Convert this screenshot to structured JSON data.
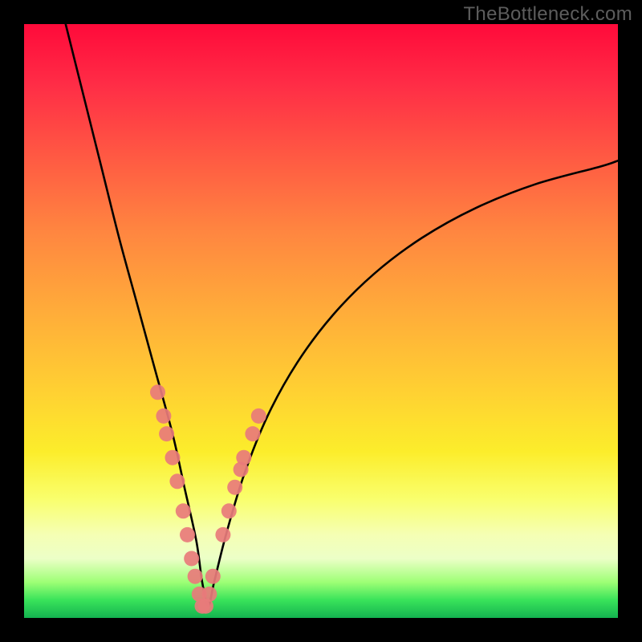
{
  "watermark_text": "TheBottleneck.com",
  "chart_data": {
    "type": "line",
    "title": "",
    "xlabel": "",
    "ylabel": "",
    "xlim": [
      0,
      100
    ],
    "ylim": [
      0,
      100
    ],
    "grid": false,
    "legend": false,
    "background_gradient": {
      "stops": [
        {
          "pos": 0,
          "color": "#ff0a3a"
        },
        {
          "pos": 35,
          "color": "#ff8640"
        },
        {
          "pos": 62,
          "color": "#ffd132"
        },
        {
          "pos": 80,
          "color": "#f9ff6d"
        },
        {
          "pos": 90,
          "color": "#ecffc7"
        },
        {
          "pos": 100,
          "color": "#14b350"
        }
      ]
    },
    "series": [
      {
        "name": "bottleneck-curve",
        "color": "#000000",
        "x": [
          7,
          10,
          13,
          16,
          19,
          22,
          25,
          27,
          29,
          30,
          31,
          32,
          34,
          37,
          41,
          46,
          52,
          59,
          67,
          76,
          86,
          97,
          100
        ],
        "y": [
          100,
          88,
          76,
          64,
          53,
          42,
          31,
          22,
          13,
          6,
          2,
          6,
          14,
          24,
          34,
          43,
          51,
          58,
          64,
          69,
          73,
          76,
          77
        ]
      },
      {
        "name": "highlight-dots",
        "type": "scatter",
        "color": "#e87b7b",
        "x": [
          22.5,
          23.5,
          24.0,
          25.0,
          25.8,
          26.8,
          27.5,
          28.2,
          28.8,
          29.5,
          30.0,
          30.6,
          31.2,
          31.8,
          33.5,
          34.5,
          35.5,
          36.5,
          37.0,
          38.5,
          39.5
        ],
        "y": [
          38,
          34,
          31,
          27,
          23,
          18,
          14,
          10,
          7,
          4,
          2,
          2,
          4,
          7,
          14,
          18,
          22,
          25,
          27,
          31,
          34
        ]
      }
    ]
  }
}
